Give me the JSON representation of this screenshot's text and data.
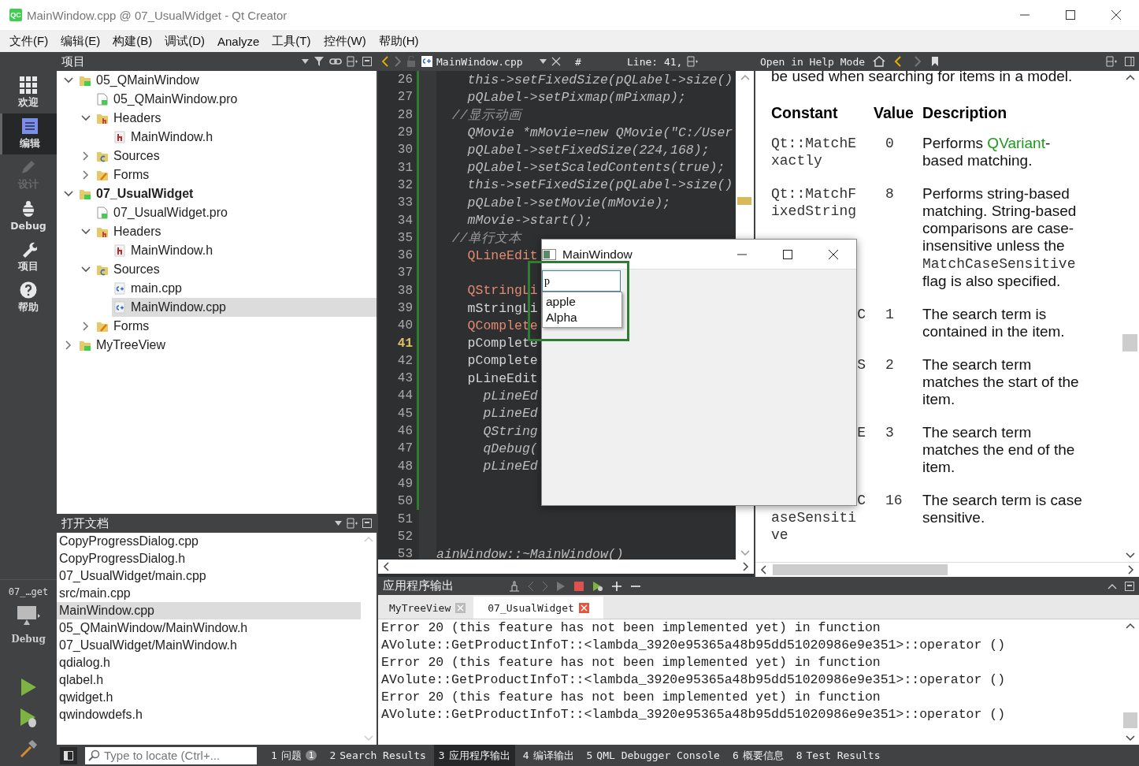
{
  "window": {
    "app_icon": "QC",
    "title": "MainWindow.cpp @ 07_UsualWidget - Qt Creator"
  },
  "menu": [
    "文件(F)",
    "编辑(E)",
    "构建(B)",
    "调试(D)",
    "Analyze",
    "工具(T)",
    "控件(W)",
    "帮助(H)"
  ],
  "modes": [
    {
      "label": "欢迎",
      "selected": false,
      "disabled": false
    },
    {
      "label": "编辑",
      "selected": true,
      "disabled": false
    },
    {
      "label": "设计",
      "selected": false,
      "disabled": true
    },
    {
      "label": "Debug",
      "selected": false,
      "disabled": false
    },
    {
      "label": "项目",
      "selected": false,
      "disabled": false
    },
    {
      "label": "帮助",
      "selected": false,
      "disabled": false
    }
  ],
  "kit": {
    "project": "07_…get",
    "build": "Debug"
  },
  "projects": {
    "title": "项目",
    "tree": [
      {
        "label": "05_QMainWindow",
        "kind": "project",
        "active": false,
        "expanded": true,
        "selected": false,
        "children": [
          {
            "label": "05_QMainWindow.pro",
            "kind": "pro",
            "selected": false
          },
          {
            "label": "Headers",
            "kind": "headers",
            "expanded": true,
            "selected": false,
            "children": [
              {
                "label": "MainWindow.h",
                "kind": "header",
                "selected": false
              }
            ]
          },
          {
            "label": "Sources",
            "kind": "sources",
            "expanded": false,
            "selected": false
          },
          {
            "label": "Forms",
            "kind": "forms",
            "expanded": false,
            "selected": false
          }
        ]
      },
      {
        "label": "07_UsualWidget",
        "kind": "project",
        "active": true,
        "expanded": true,
        "selected": false,
        "children": [
          {
            "label": "07_UsualWidget.pro",
            "kind": "pro",
            "selected": false
          },
          {
            "label": "Headers",
            "kind": "headers",
            "expanded": true,
            "selected": false,
            "children": [
              {
                "label": "MainWindow.h",
                "kind": "header",
                "selected": false
              }
            ]
          },
          {
            "label": "Sources",
            "kind": "sources",
            "expanded": true,
            "selected": false,
            "children": [
              {
                "label": "main.cpp",
                "kind": "source",
                "selected": false
              },
              {
                "label": "MainWindow.cpp",
                "kind": "source",
                "selected": true
              }
            ]
          },
          {
            "label": "Forms",
            "kind": "forms",
            "expanded": false,
            "selected": false
          }
        ]
      },
      {
        "label": "MyTreeView",
        "kind": "project",
        "active": false,
        "expanded": false,
        "selected": false
      }
    ]
  },
  "open_documents": {
    "title": "打开文档",
    "items": [
      {
        "label": "CopyProgressDialog.cpp",
        "selected": false
      },
      {
        "label": "CopyProgressDialog.h",
        "selected": false
      },
      {
        "label": "07_UsualWidget/main.cpp",
        "selected": false
      },
      {
        "label": "src/main.cpp",
        "selected": false
      },
      {
        "label": "MainWindow.cpp",
        "selected": true
      },
      {
        "label": "05_QMainWindow/MainWindow.h",
        "selected": false
      },
      {
        "label": "07_UsualWidget/MainWindow.h",
        "selected": false
      },
      {
        "label": "qdialog.h",
        "selected": false
      },
      {
        "label": "qlabel.h",
        "selected": false
      },
      {
        "label": "qwidget.h",
        "selected": false
      },
      {
        "label": "qwindowdefs.h",
        "selected": false
      }
    ]
  },
  "editor": {
    "file": "MainWindow.cpp",
    "symbol": "#",
    "position": "Line: 41,",
    "lines": [
      {
        "number": "26",
        "text": "    this->setFixedSize(pQLabel->size()",
        "kind": "code",
        "changed": true,
        "current": false
      },
      {
        "number": "27",
        "text": "    pQLabel->setPixmap(mPixmap);",
        "kind": "code",
        "changed": true,
        "current": false
      },
      {
        "number": "28",
        "text": "  //显示动画",
        "kind": "comment",
        "changed": true,
        "current": false
      },
      {
        "number": "29",
        "text": "    QMovie *mMovie=new QMovie(\"C:/User",
        "kind": "code",
        "changed": true,
        "current": false
      },
      {
        "number": "30",
        "text": "    pQLabel->setFixedSize(224,168);",
        "kind": "code",
        "changed": true,
        "current": false
      },
      {
        "number": "31",
        "text": "    pQLabel->setScaledContents(true);",
        "kind": "code",
        "changed": true,
        "current": false
      },
      {
        "number": "32",
        "text": "    this->setFixedSize(pQLabel->size()",
        "kind": "code",
        "changed": true,
        "current": false
      },
      {
        "number": "33",
        "text": "    pQLabel->setMovie(mMovie);",
        "kind": "code",
        "changed": true,
        "current": false
      },
      {
        "number": "34",
        "text": "    mMovie->start();",
        "kind": "code",
        "changed": true,
        "current": false
      },
      {
        "number": "35",
        "text": "  //单行文本",
        "kind": "comment",
        "changed": true,
        "current": false
      },
      {
        "number": "36",
        "text": "    QLineEdit",
        "kind": "type",
        "changed": true,
        "current": false
      },
      {
        "number": "37",
        "changed": true,
        "current": false
      },
      {
        "number": "38",
        "text": "    QStringLi",
        "kind": "type",
        "changed": true,
        "current": false
      },
      {
        "number": "39",
        "text": "    mStringLi",
        "kind": "plain",
        "changed": true,
        "current": false
      },
      {
        "number": "40",
        "text": "    QComplete",
        "kind": "type",
        "changed": true,
        "current": false
      },
      {
        "number": "41",
        "text": "    pComplete",
        "kind": "plain",
        "changed": true,
        "current": true
      },
      {
        "number": "42",
        "text": "    pComplete",
        "kind": "plain",
        "changed": true,
        "current": false
      },
      {
        "number": "43",
        "text": "    pLineEdit",
        "kind": "plain",
        "changed": true,
        "current": false
      },
      {
        "number": "44",
        "text": "      pLineEd",
        "kind": "code",
        "changed": true,
        "current": false
      },
      {
        "number": "45",
        "text": "      pLineEd",
        "kind": "code",
        "changed": true,
        "current": false
      },
      {
        "number": "46",
        "text": "      QString",
        "kind": "code",
        "changed": true,
        "current": false
      },
      {
        "number": "47",
        "text": "      qDebug(",
        "kind": "code",
        "changed": true,
        "current": false
      },
      {
        "number": "48",
        "text": "      pLineEd",
        "kind": "code",
        "changed": true,
        "current": false
      },
      {
        "number": "49",
        "changed": true,
        "current": false
      },
      {
        "number": "50",
        "changed": true,
        "current": false
      },
      {
        "number": "51",
        "changed": false,
        "current": false
      },
      {
        "number": "52",
        "changed": false,
        "current": false
      },
      {
        "number": "53",
        "text": "ainWindow::~MainWindow()",
        "kind": "code",
        "changed": false,
        "current": false
      }
    ]
  },
  "help": {
    "toolbar_label": "Open in Help Mode",
    "intro": "be used when searching for items in a model.",
    "columns": [
      "Constant",
      "Value",
      "Description"
    ],
    "rows": [
      {
        "constant": [
          "Qt::MatchE",
          "xactly"
        ],
        "covered": false,
        "value": "0",
        "description": [
          {
            "kind": "text",
            "text": "Performs "
          },
          {
            "kind": "link",
            "text": "QVariant"
          },
          {
            "kind": "text",
            "text": "-based matching."
          }
        ]
      },
      {
        "constant": [
          "Qt::MatchF",
          "ixedString"
        ],
        "covered": false,
        "value": "8",
        "description": [
          {
            "kind": "text",
            "text": "Performs string-based matching. String-based comparisons are case-insensitive unless the "
          },
          {
            "kind": "code",
            "text": "MatchCaseSensitive"
          },
          {
            "kind": "text",
            "text": " flag is also specified."
          }
        ]
      },
      {
        "constant": [
          "C"
        ],
        "covered": true,
        "value": "1",
        "description": [
          {
            "kind": "text",
            "text": "The search term is contained in the item."
          }
        ]
      },
      {
        "constant": [
          "S"
        ],
        "covered": true,
        "value": "2",
        "description": [
          {
            "kind": "text",
            "text": "The search term matches the start of the item."
          }
        ]
      },
      {
        "constant": [
          "E"
        ],
        "covered": true,
        "value": "3",
        "description": [
          {
            "kind": "text",
            "text": "The search term matches the end of the item."
          }
        ]
      },
      {
        "constant": [
          "C",
          "aseSensiti",
          "ve"
        ],
        "covered": true,
        "value": "16",
        "description": [
          {
            "kind": "text",
            "text": "The search term is case sensitive."
          }
        ]
      }
    ]
  },
  "dialog": {
    "title": "MainWindow",
    "input": {
      "value": "p"
    },
    "completions": [
      "apple",
      "Alpha"
    ]
  },
  "output": {
    "title": "应用程序输出",
    "tabs": [
      {
        "label": "MyTreeView",
        "selected": false
      },
      {
        "label": "07_UsualWidget",
        "selected": true
      }
    ],
    "lines": [
      "Error 20 (this feature has not been implemented yet) in function",
      "AVolute::GetProductInfoT::<lambda_3920e95365a48b95dd51020986e9e351>::operator ()",
      "Error 20 (this feature has not been implemented yet) in function",
      "AVolute::GetProductInfoT::<lambda_3920e95365a48b95dd51020986e9e351>::operator ()",
      "Error 20 (this feature has not been implemented yet) in function",
      "AVolute::GetProductInfoT::<lambda_3920e95365a48b95dd51020986e9e351>::operator ()"
    ]
  },
  "status_bar": {
    "locate_placeholder": "Type to locate (Ctrl+...",
    "tabs": [
      {
        "number": "1",
        "label": "问题",
        "badge": "1",
        "selected": false
      },
      {
        "number": "2",
        "label": "Search Results",
        "selected": false
      },
      {
        "number": "3",
        "label": "应用程序输出",
        "selected": true
      },
      {
        "number": "4",
        "label": "编译输出",
        "selected": false
      },
      {
        "number": "5",
        "label": "QML Debugger Console",
        "selected": false
      },
      {
        "number": "6",
        "label": "概要信息",
        "selected": false
      },
      {
        "number": "8",
        "label": "Test Results",
        "selected": false
      }
    ]
  }
}
